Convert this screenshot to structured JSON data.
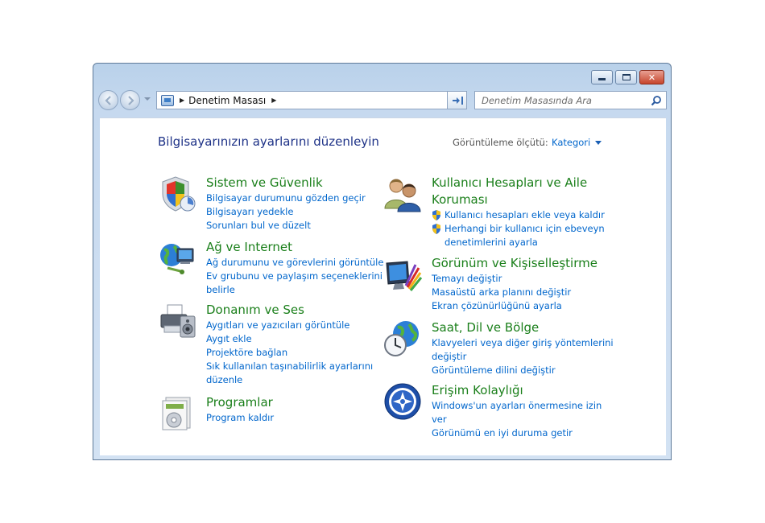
{
  "window": {
    "controls": {
      "minimize": "minimize",
      "maximize": "maximize",
      "close": "close"
    },
    "breadcrumb": [
      "Denetim Masası"
    ],
    "search": {
      "placeholder": "Denetim Masasında Ara"
    }
  },
  "content": {
    "heading": "Bilgisayarınızın ayarlarını düzenleyin",
    "view_by_label": "Görüntüleme ölçütü:",
    "view_by_value": "Kategori"
  },
  "categories_left": [
    {
      "title": "Sistem ve Güvenlik",
      "icon": "shield-icon",
      "links": [
        "Bilgisayar durumunu gözden geçir",
        "Bilgisayarı yedekle",
        "Sorunları bul ve düzelt"
      ]
    },
    {
      "title": "Ağ ve Internet",
      "icon": "network-icon",
      "links": [
        "Ağ durumunu ve görevlerini görüntüle",
        "Ev grubunu ve paylaşım seçeneklerini",
        "belirle"
      ]
    },
    {
      "title": "Donanım ve Ses",
      "icon": "printer-icon",
      "links": [
        "Aygıtları ve yazıcıları görüntüle",
        "Aygıt ekle",
        "Projektöre bağlan",
        "Sık kullanılan taşınabilirlik ayarlarını",
        "düzenle"
      ]
    },
    {
      "title": "Programlar",
      "icon": "programs-icon",
      "links": [
        "Program kaldır"
      ]
    }
  ],
  "categories_right": [
    {
      "title_line1": "Kullanıcı Hesapları ve Aile",
      "title_line2": "Koruması",
      "icon": "users-icon",
      "links": [
        "Kullanıcı hesapları ekle veya kaldır",
        "Herhangi bir kullanıcı için ebeveyn",
        "denetimlerini ayarla"
      ]
    },
    {
      "title": "Görünüm ve Kişiselleştirme",
      "icon": "monitor-icon",
      "links": [
        "Temayı değiştir",
        "Masaüstü arka planını değiştir",
        "Ekran çözünürlüğünü ayarla"
      ]
    },
    {
      "title": "Saat, Dil ve Bölge",
      "icon": "clock-globe-icon",
      "links": [
        "Klavyeleri veya diğer giriş yöntemlerini",
        "değiştir",
        "Görüntüleme dilini değiştir"
      ]
    },
    {
      "title": "Erişim Kolaylığı",
      "icon": "accessibility-icon",
      "links": [
        "Windows'un ayarları önermesine izin",
        "ver",
        "Görünümü en iyi duruma getir"
      ]
    }
  ],
  "colors": {
    "category_title": "#1a7f1a",
    "link": "#0066cc",
    "heading": "#1e3287"
  }
}
